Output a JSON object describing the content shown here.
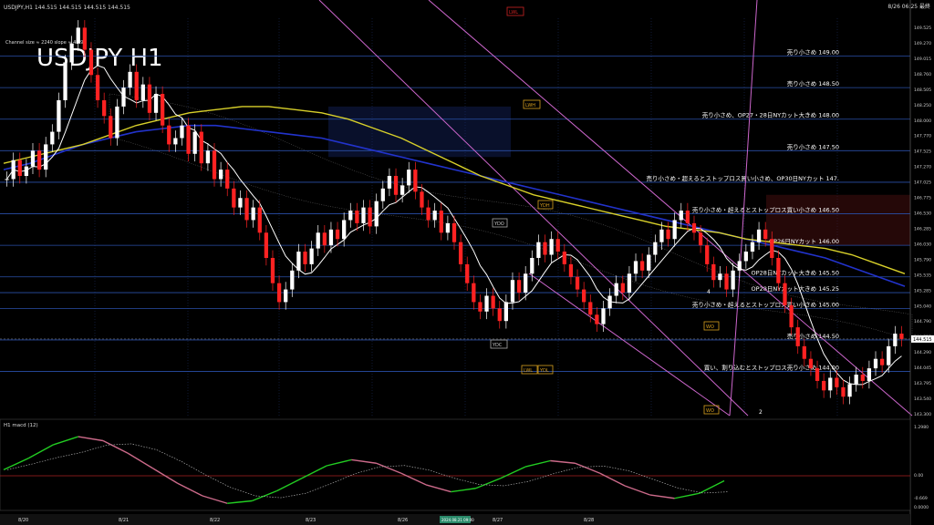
{
  "window": {
    "symbol_header": "USDJPY,H1  144.515  144.515  144.515  144.515",
    "big_title": "USDJPY H1",
    "channel_note": "Channel size ≈ 2240  slope ≈ 45.9",
    "datetime": "8/26 06:25 最終"
  },
  "markers": {
    "lwl_top": "LWL",
    "lwh": "LWH",
    "ydh": "YDH",
    "ydo": "YDO",
    "ydc": "YDC",
    "lwl_bottom": "LWL",
    "ydl": "YDL",
    "wo_top": "WO",
    "wo_bottom": "WO",
    "pivot_4": "4",
    "pivot_2": "2"
  },
  "colors": {
    "bg": "#000000",
    "grid": "#1b2c5a",
    "hline": "#2a4fa8",
    "bull": "#ffffff",
    "bear": "#ff2222",
    "macd_up": "#22cc22",
    "macd_down": "#cc6a8a",
    "signal": "#aaaaaa",
    "cloud": "#6f6f6f",
    "yellow_ma": "#d8d02a",
    "blue_ma": "#2233cc",
    "white_ma": "#ffffff",
    "channel": "#cc66cc",
    "price_label": "#ffffff"
  },
  "price_axis": {
    "ticks": [
      "149.525",
      "149.270",
      "149.015",
      "148.760",
      "148.505",
      "148.250",
      "148.000",
      "147.770",
      "147.525",
      "147.270",
      "147.025",
      "146.775",
      "146.530",
      "146.285",
      "146.030",
      "145.790",
      "145.535",
      "145.285",
      "145.040",
      "144.790",
      "144.535",
      "144.290",
      "144.045",
      "143.795",
      "143.540",
      "143.300"
    ],
    "current": "144.515"
  },
  "levels": [
    {
      "price": 149.0,
      "label": "売り小さめ 149.00"
    },
    {
      "price": 148.5,
      "label": "売り小さめ 148.50"
    },
    {
      "price": 148.0,
      "label": "売り小さめ、OP27・28日NYカット大きめ 148.00"
    },
    {
      "price": 147.5,
      "label": "売り小さめ 147.50"
    },
    {
      "price": 147.0,
      "label": "売り小さめ・超えるとストップロス買い小さめ、OP30日NYカット 147."
    },
    {
      "price": 146.5,
      "label": "売り小さめ・超えるとストップロス買い小さめ 146.50"
    },
    {
      "price": 146.0,
      "label": "OP26日NYカット 146.00"
    },
    {
      "price": 145.5,
      "label": "OP28日NYカット大きめ 145.50"
    },
    {
      "price": 145.25,
      "label": "OP28日NYカット大きめ 145.25"
    },
    {
      "price": 145.0,
      "label": "売り小さめ・超えるとストップロス買い小さめ 145.00"
    },
    {
      "price": 144.5,
      "label": "売り小さめ 144.50"
    },
    {
      "price": 144.0,
      "label": "買い、割り込むとストップロス売り小さめ 144.00"
    }
  ],
  "macd": {
    "label": "H1 macd (12)",
    "ticks": [
      "1.2980",
      "0.00",
      "-0.669",
      "0.0000"
    ]
  },
  "time_axis": {
    "labels": [
      "8/20",
      "8/21",
      "8/22",
      "8/23",
      "8/26",
      "8/27",
      "8/28"
    ],
    "cursor_label": "2024.08.21 09:00"
  },
  "chart_data": {
    "type": "candlestick",
    "symbol": "USDJPY",
    "timeframe": "H1",
    "ylim": [
      143.3,
      149.6
    ],
    "current_price": 144.515,
    "x_labels": [
      "8/20",
      "8/21",
      "8/22",
      "8/23",
      "8/26",
      "8/27",
      "8/28"
    ],
    "closes": [
      147.05,
      147.35,
      147.1,
      147.25,
      147.5,
      147.2,
      147.6,
      147.8,
      148.3,
      148.9,
      149.2,
      149.45,
      149.1,
      148.7,
      148.3,
      148.05,
      147.7,
      148.2,
      148.5,
      148.75,
      148.3,
      148.55,
      148.1,
      148.4,
      147.9,
      147.6,
      147.7,
      147.9,
      147.45,
      147.8,
      147.3,
      147.5,
      147.05,
      147.2,
      146.9,
      146.6,
      146.75,
      146.4,
      146.6,
      146.2,
      145.8,
      145.4,
      145.1,
      145.3,
      145.6,
      145.9,
      145.7,
      145.95,
      146.2,
      146.0,
      146.25,
      146.1,
      146.4,
      146.55,
      146.35,
      146.6,
      146.3,
      146.7,
      146.9,
      147.1,
      146.8,
      146.95,
      147.2,
      146.85,
      146.6,
      146.4,
      146.55,
      146.2,
      146.35,
      146.05,
      145.7,
      145.4,
      145.1,
      144.95,
      145.2,
      145.0,
      144.8,
      145.1,
      145.45,
      145.25,
      145.55,
      145.8,
      146.05,
      145.85,
      146.1,
      145.9,
      145.7,
      145.5,
      145.3,
      145.1,
      144.9,
      144.75,
      145.0,
      145.2,
      145.4,
      145.25,
      145.55,
      145.75,
      145.6,
      145.85,
      146.05,
      146.25,
      146.1,
      146.4,
      146.55,
      146.35,
      146.2,
      146.0,
      145.7,
      145.45,
      145.55,
      145.3,
      145.6,
      145.75,
      145.9,
      146.05,
      146.25,
      146.1,
      145.8,
      145.4,
      145.05,
      144.7,
      144.4,
      144.2,
      144.05,
      143.85,
      143.7,
      143.9,
      143.75,
      143.6,
      143.8,
      143.95,
      143.85,
      144.05,
      144.2,
      144.1,
      144.4,
      144.6,
      144.515
    ],
    "series": [
      {
        "name": "yellow_ma",
        "values": [
          147.3,
          147.4,
          147.5,
          147.6,
          147.75,
          147.9,
          148.0,
          148.1,
          148.15,
          148.2,
          148.2,
          148.15,
          148.1,
          148.0,
          147.85,
          147.7,
          147.5,
          147.3,
          147.1,
          146.95,
          146.8,
          146.7,
          146.6,
          146.5,
          146.4,
          146.3,
          146.25,
          146.2,
          146.1,
          146.05,
          146.0,
          145.95,
          145.85,
          145.7,
          145.55
        ]
      },
      {
        "name": "blue_ma",
        "values": [
          147.2,
          147.3,
          147.45,
          147.6,
          147.7,
          147.8,
          147.85,
          147.9,
          147.9,
          147.85,
          147.8,
          147.75,
          147.7,
          147.6,
          147.5,
          147.4,
          147.3,
          147.2,
          147.1,
          147.0,
          146.9,
          146.8,
          146.7,
          146.6,
          146.5,
          146.4,
          146.3,
          146.2,
          146.1,
          146.0,
          145.9,
          145.8,
          145.65,
          145.5,
          145.35
        ]
      },
      {
        "name": "macd",
        "values": [
          0.12,
          0.35,
          0.62,
          0.78,
          0.7,
          0.45,
          0.15,
          -0.15,
          -0.4,
          -0.55,
          -0.5,
          -0.3,
          -0.05,
          0.2,
          0.32,
          0.25,
          0.05,
          -0.18,
          -0.32,
          -0.25,
          -0.05,
          0.18,
          0.3,
          0.25,
          0.05,
          -0.2,
          -0.38,
          -0.45,
          -0.35,
          -0.1
        ]
      }
    ]
  }
}
